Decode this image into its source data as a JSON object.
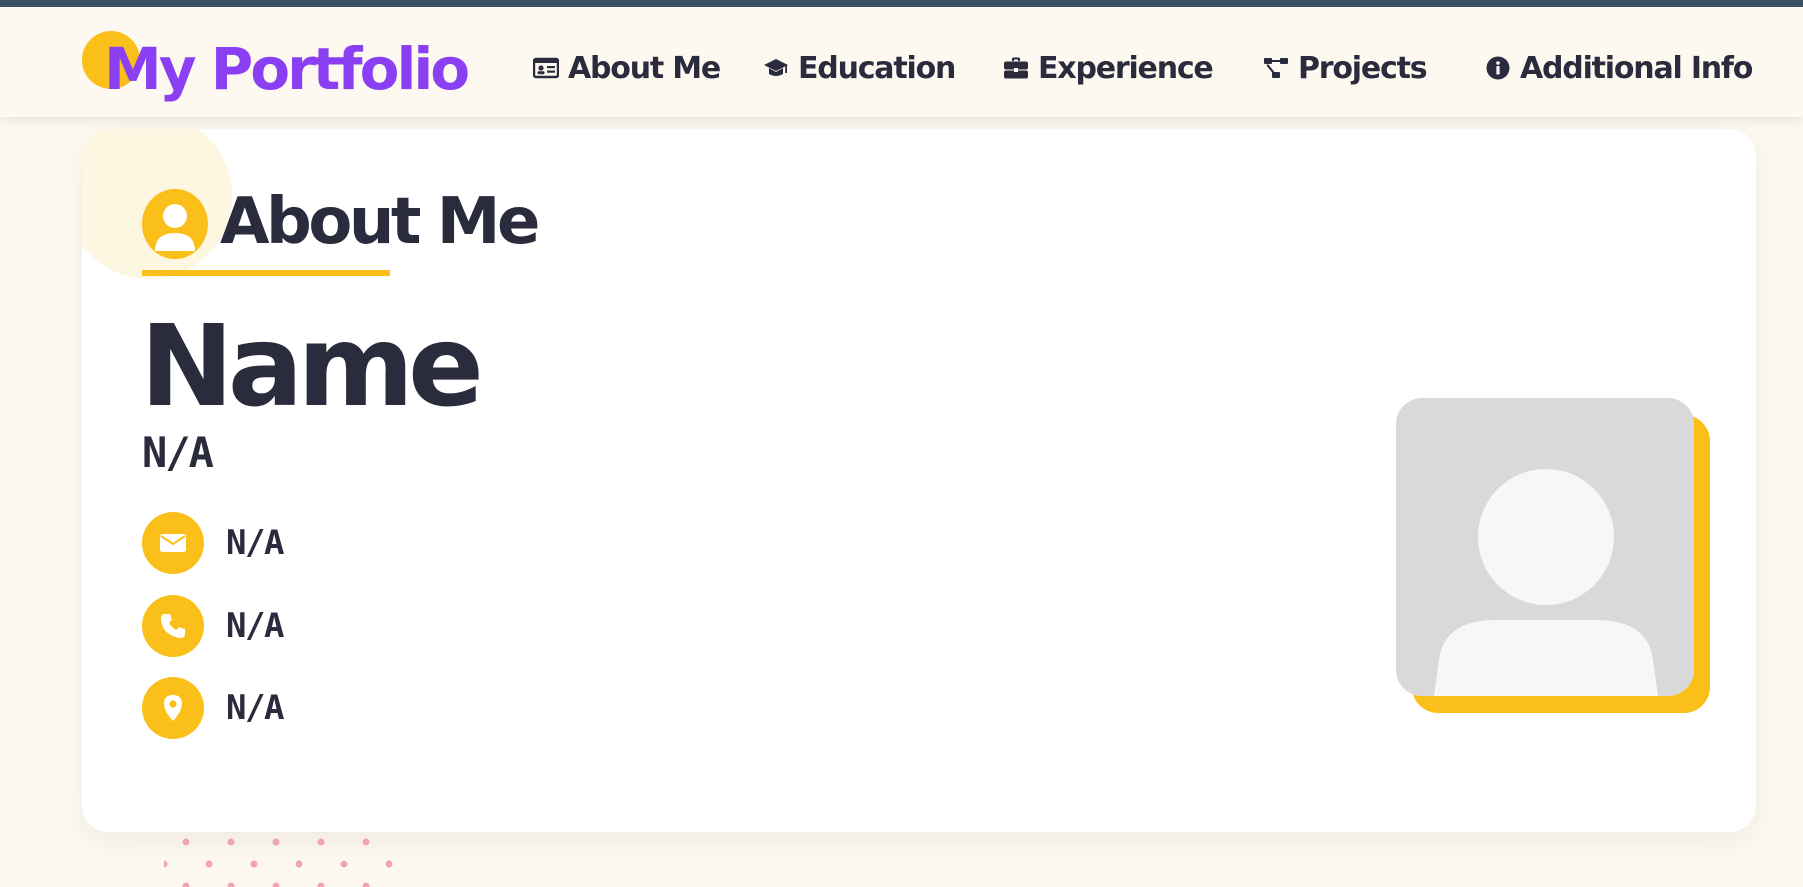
{
  "navbar": {
    "logo_text": "My Portfolio",
    "items": [
      {
        "label": "About Me",
        "icon": "id-card-icon"
      },
      {
        "label": "Education",
        "icon": "graduation-cap-icon"
      },
      {
        "label": "Experience",
        "icon": "briefcase-icon"
      },
      {
        "label": "Projects",
        "icon": "project-diagram-icon"
      },
      {
        "label": "Additional Info",
        "icon": "info-circle-icon"
      }
    ]
  },
  "about": {
    "section_title": "About Me",
    "section_icon": "user-circle-icon",
    "name_heading": "Name",
    "name_value": "N/A",
    "contacts": [
      {
        "icon": "envelope-icon",
        "value": "N/A"
      },
      {
        "icon": "phone-icon",
        "value": "N/A"
      },
      {
        "icon": "map-marker-icon",
        "value": "N/A"
      }
    ],
    "photo": "avatar-placeholder"
  },
  "colors": {
    "accent": "#fbbf1a",
    "brand": "#8a3ff2",
    "text": "#2a2b3d",
    "background": "#fdf9f1",
    "top_strip": "#3f5166",
    "dots": "#f3a3b8"
  }
}
